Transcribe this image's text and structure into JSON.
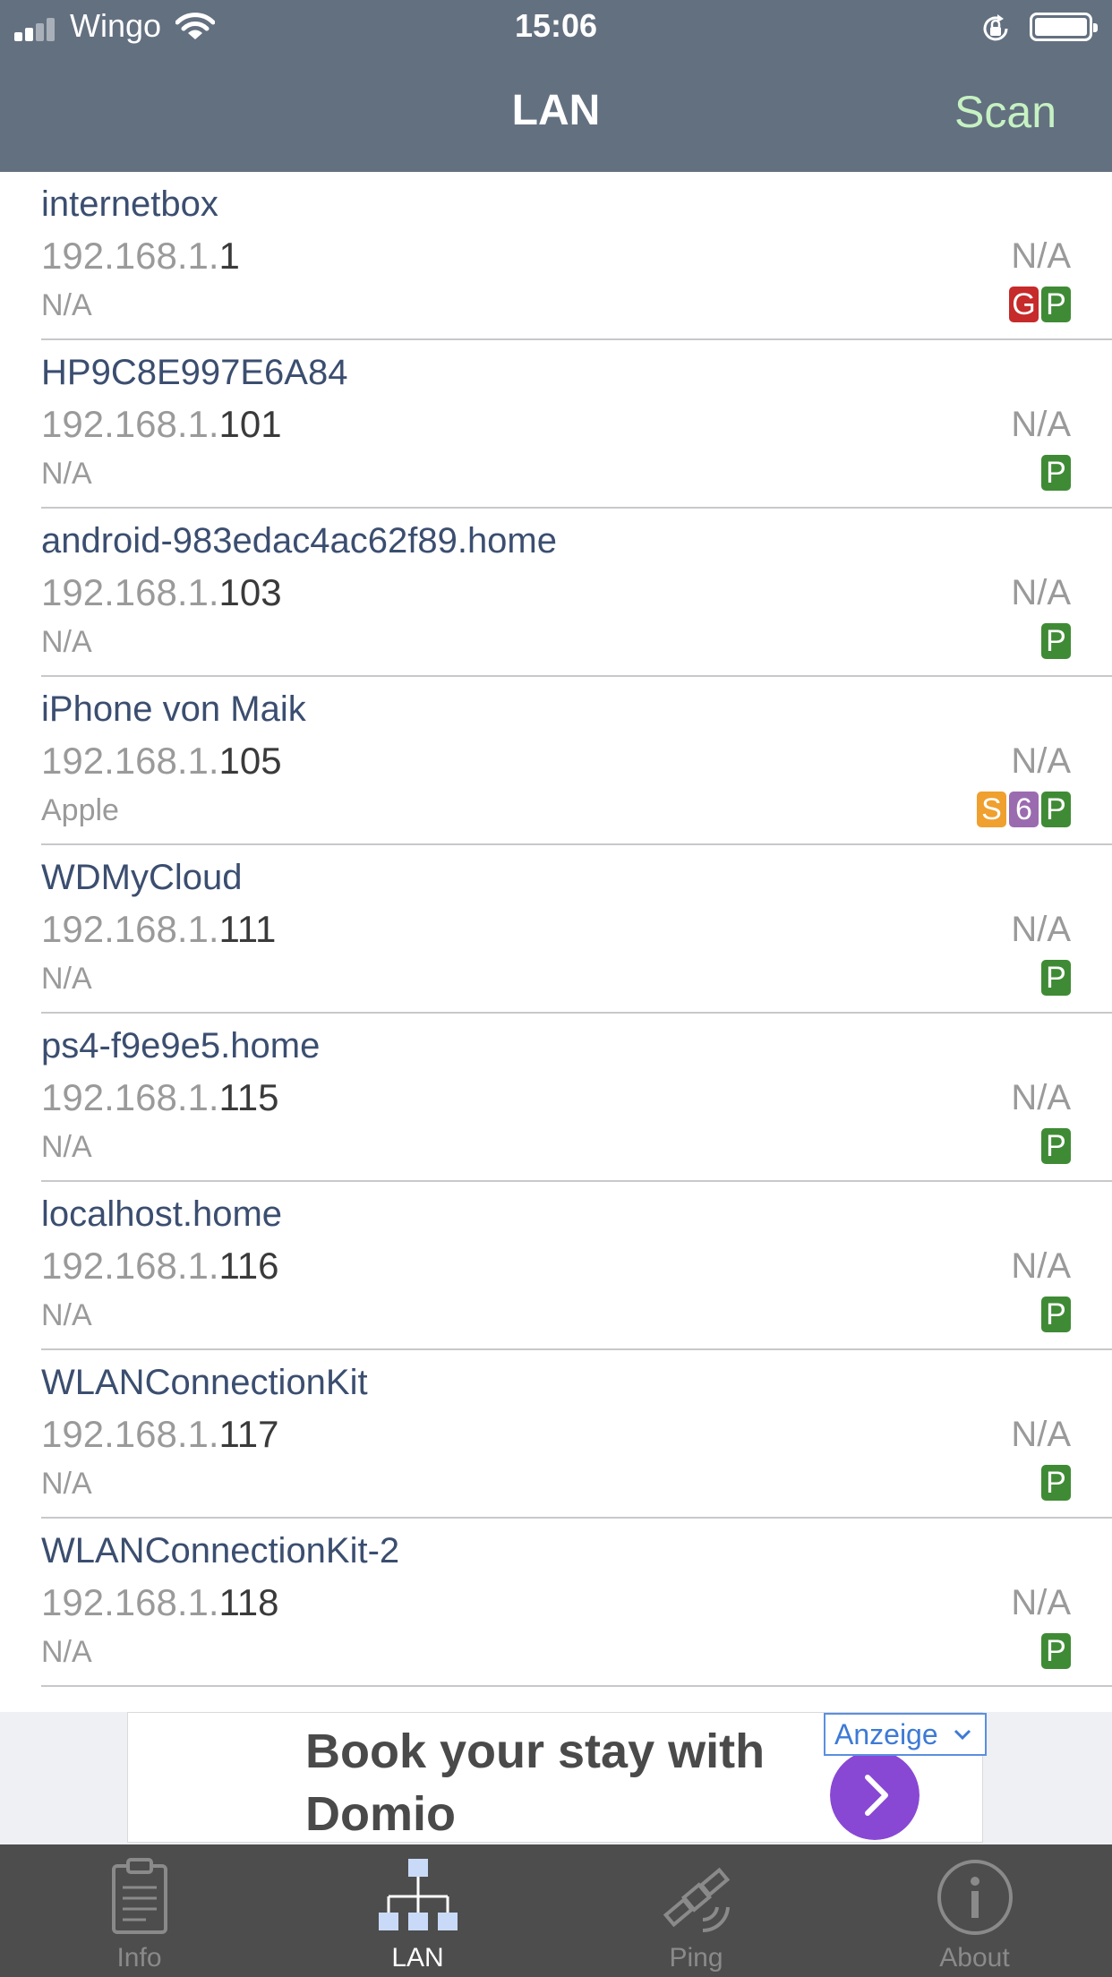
{
  "status_bar": {
    "carrier": "Wingo",
    "time": "15:06",
    "signal_bars_active": 2,
    "battery_level": 0.95
  },
  "nav": {
    "title": "LAN",
    "scan_label": "Scan"
  },
  "devices": [
    {
      "name": "internetbox",
      "ip_prefix": "192.168.1.",
      "ip_suffix": "1",
      "vendor": "N/A",
      "mac": "N/A",
      "badges": [
        {
          "letter": "G",
          "color": "#c62a2a"
        },
        {
          "letter": "P",
          "color": "#3f8b35"
        }
      ]
    },
    {
      "name": "HP9C8E997E6A84",
      "ip_prefix": "192.168.1.",
      "ip_suffix": "101",
      "vendor": "N/A",
      "mac": "N/A",
      "badges": [
        {
          "letter": "P",
          "color": "#3f8b35"
        }
      ]
    },
    {
      "name": "android-983edac4ac62f89.home",
      "ip_prefix": "192.168.1.",
      "ip_suffix": "103",
      "vendor": "N/A",
      "mac": "N/A",
      "badges": [
        {
          "letter": "P",
          "color": "#3f8b35"
        }
      ]
    },
    {
      "name": "iPhone von Maik",
      "ip_prefix": "192.168.1.",
      "ip_suffix": "105",
      "vendor": "Apple",
      "mac": "N/A",
      "badges": [
        {
          "letter": "S",
          "color": "#efa02f"
        },
        {
          "letter": "6",
          "color": "#9b6bb0"
        },
        {
          "letter": "P",
          "color": "#3f8b35"
        }
      ]
    },
    {
      "name": "WDMyCloud",
      "ip_prefix": "192.168.1.",
      "ip_suffix": "111",
      "vendor": "N/A",
      "mac": "N/A",
      "badges": [
        {
          "letter": "P",
          "color": "#3f8b35"
        }
      ]
    },
    {
      "name": "ps4-f9e9e5.home",
      "ip_prefix": "192.168.1.",
      "ip_suffix": "115",
      "vendor": "N/A",
      "mac": "N/A",
      "badges": [
        {
          "letter": "P",
          "color": "#3f8b35"
        }
      ]
    },
    {
      "name": "localhost.home",
      "ip_prefix": "192.168.1.",
      "ip_suffix": "116",
      "vendor": "N/A",
      "mac": "N/A",
      "badges": [
        {
          "letter": "P",
          "color": "#3f8b35"
        }
      ]
    },
    {
      "name": "WLANConnectionKit",
      "ip_prefix": "192.168.1.",
      "ip_suffix": "117",
      "vendor": "N/A",
      "mac": "N/A",
      "badges": [
        {
          "letter": "P",
          "color": "#3f8b35"
        }
      ]
    },
    {
      "name": "WLANConnectionKit-2",
      "ip_prefix": "192.168.1.",
      "ip_suffix": "118",
      "vendor": "N/A",
      "mac": "N/A",
      "badges": [
        {
          "letter": "P",
          "color": "#3f8b35"
        }
      ]
    }
  ],
  "ad": {
    "text": "Book your stay with Domio",
    "tag": "Anzeige"
  },
  "tabs": [
    {
      "label": "Info",
      "icon": "clipboard-icon",
      "active": false
    },
    {
      "label": "LAN",
      "icon": "network-icon",
      "active": true
    },
    {
      "label": "Ping",
      "icon": "satellite-icon",
      "active": false
    },
    {
      "label": "About",
      "icon": "info-circle-icon",
      "active": false
    }
  ],
  "colors": {
    "header_bg": "#637080",
    "scan": "#c6f2c2",
    "device_name": "#3b4e70",
    "tabbar_bg": "#4d4d4d"
  }
}
